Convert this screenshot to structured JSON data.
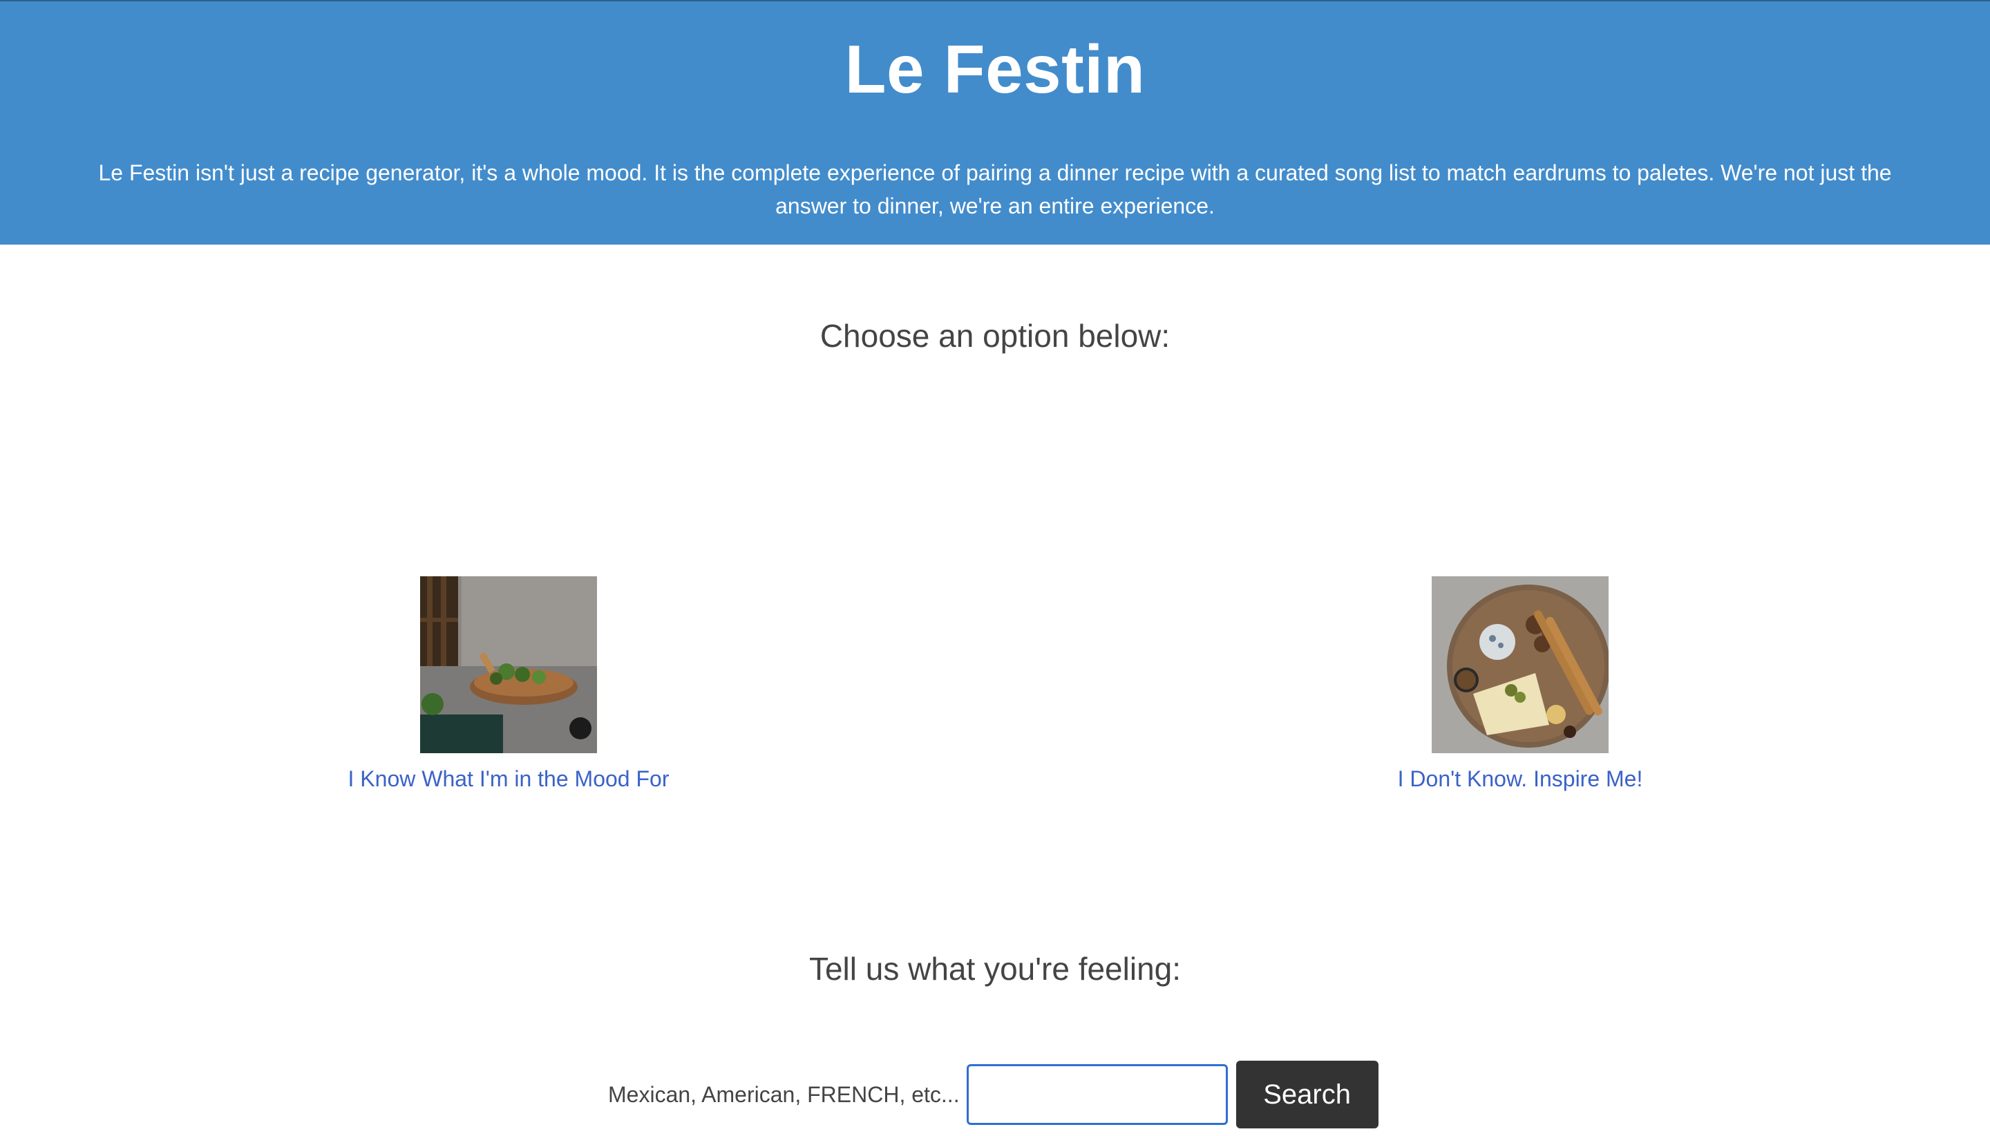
{
  "header": {
    "title": "Le Festin",
    "description": "Le Festin isn't just a recipe generator, it's a whole mood. It is the complete experience of pairing a dinner recipe with a curated song list to match eardrums to paletes. We're not just the answer to dinner, we're an entire experience."
  },
  "options": {
    "heading": "Choose an option below:",
    "items": [
      {
        "label": "I Know What I'm in the Mood For",
        "image": "food-board-photo"
      },
      {
        "label": "I Don't Know. Inspire Me!",
        "image": "charcuterie-board-photo"
      }
    ]
  },
  "search": {
    "heading": "Tell us what you're feeling:",
    "label": "Mexican, American, FRENCH, etc...",
    "value": "",
    "button_label": "Search"
  },
  "colors": {
    "header_bg": "#428ccc",
    "link": "#3a62c8",
    "button_bg": "#333333",
    "input_border": "#2f6fd0"
  }
}
